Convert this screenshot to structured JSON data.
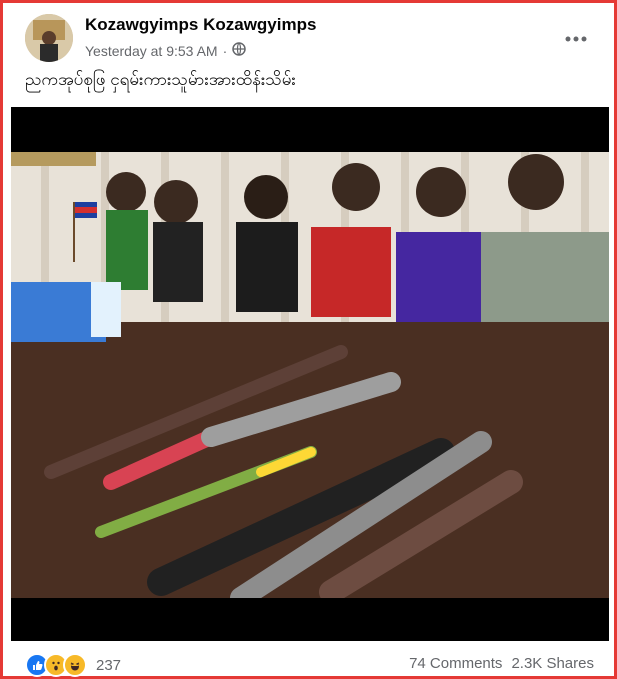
{
  "post": {
    "author": "Kozawgyimps Kozawgyimps",
    "timestamp": "Yesterday at 9:53 AM",
    "separator": "·",
    "audience_icon": "globe-icon",
    "more_icon": "more-options-icon",
    "caption": "ညကအုပ်စုဖြ ငှရမ်းကားသူမ်ားအားထိန်းသိမ်း"
  },
  "engagement": {
    "reactions": [
      "like-icon",
      "wow-icon",
      "haha-icon"
    ],
    "reaction_count": "237",
    "comments": "74 Comments",
    "shares": "2.3K Shares"
  },
  "colors": {
    "frame_border": "#e53935",
    "like_blue": "#1877f2",
    "reaction_yellow": "#f7b928"
  }
}
